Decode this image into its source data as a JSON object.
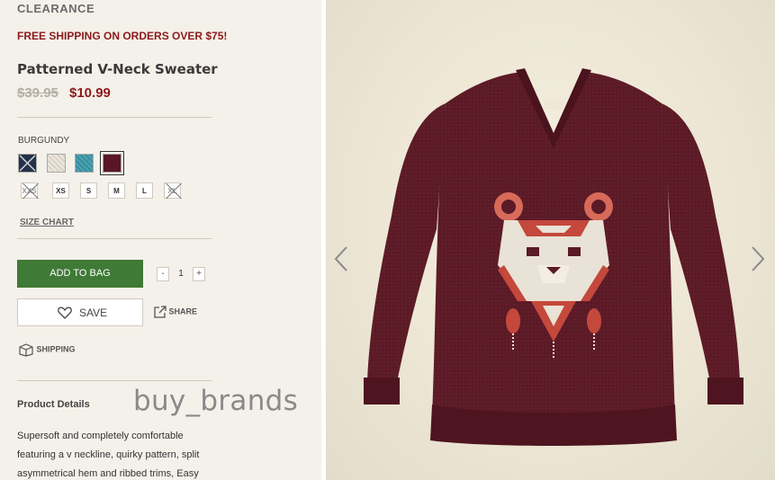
{
  "header": {
    "category": "CLEARANCE",
    "promo": "FREE SHIPPING ON ORDERS OVER $75!"
  },
  "product": {
    "title": "Patterned V-Neck Sweater",
    "original_price": "$39.95",
    "sale_price": "$10.99",
    "selected_color": "BURGUNDY",
    "colors": [
      {
        "name": "navy",
        "hex": "#233247",
        "available": false
      },
      {
        "name": "cream",
        "hex": "#e7e2d7",
        "available": true
      },
      {
        "name": "teal",
        "hex": "#3f97a8",
        "available": true
      },
      {
        "name": "burgundy",
        "hex": "#5a1624",
        "available": true,
        "selected": true
      }
    ],
    "sizes": [
      {
        "label": "XXS",
        "available": false
      },
      {
        "label": "XS",
        "available": true
      },
      {
        "label": "S",
        "available": true
      },
      {
        "label": "M",
        "available": true
      },
      {
        "label": "L",
        "available": true
      },
      {
        "label": "XL",
        "available": false
      }
    ],
    "size_chart_label": "SIZE CHART"
  },
  "actions": {
    "add_to_bag": "ADD TO BAG",
    "qty_minus": "-",
    "quantity": "1",
    "qty_plus": "+",
    "save": "SAVE",
    "share": "SHARE",
    "shipping": "SHIPPING"
  },
  "details": {
    "heading": "Product Details",
    "watermark": "buy_brands",
    "description": "Supersoft and completely comfortable featuring a v neckline, quirky pattern, split asymmetrical hem and ribbed trims, Easy"
  },
  "gallery": {
    "prev_icon": "chevron-left-icon",
    "next_icon": "chevron-right-icon",
    "sweater_color": "#5a1a26"
  }
}
